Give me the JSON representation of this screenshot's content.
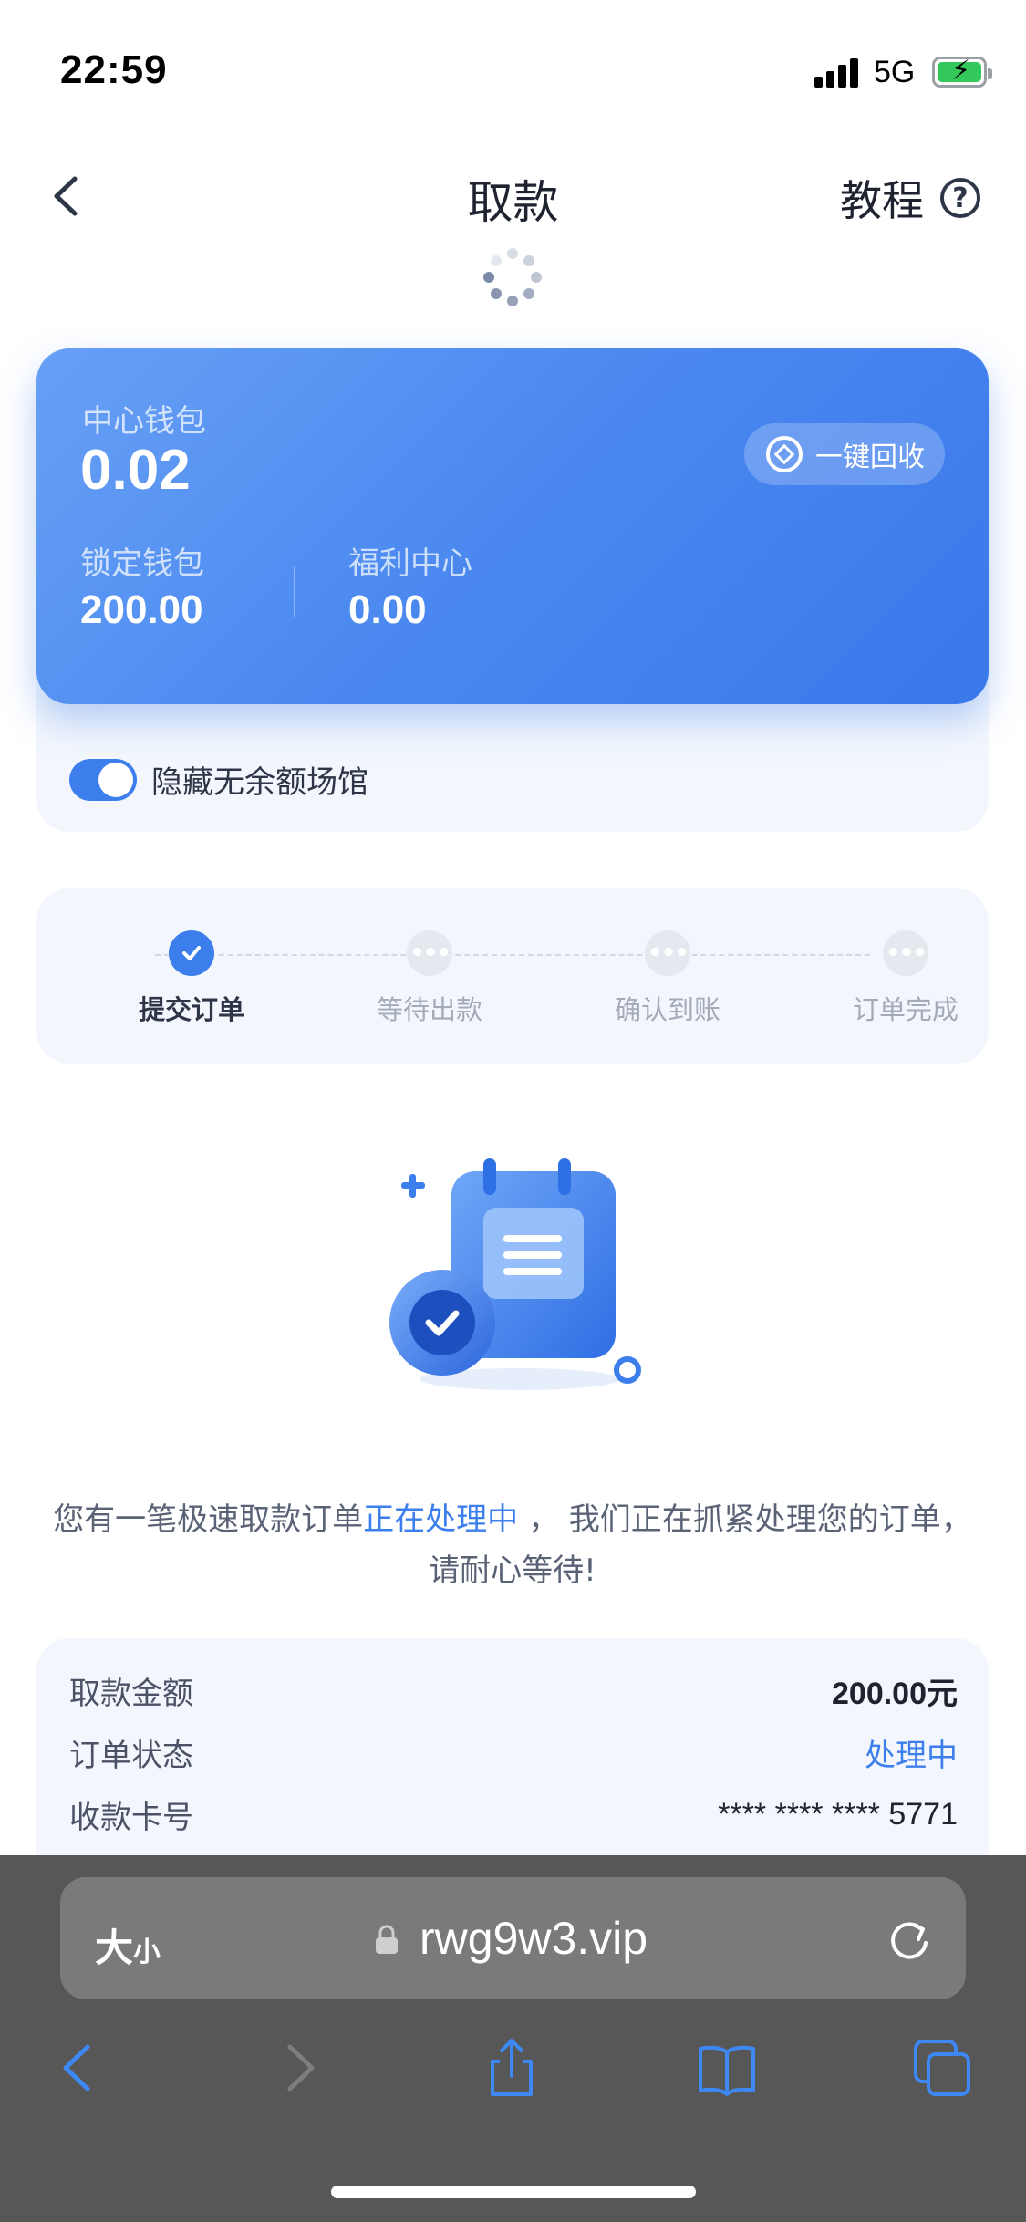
{
  "status_bar": {
    "time": "22:59",
    "network": "5G"
  },
  "nav": {
    "title": "取款",
    "tutorial": "教程"
  },
  "wallet": {
    "main_label": "中心钱包",
    "main_value": "0.02",
    "locked_label": "锁定钱包",
    "locked_value": "200.00",
    "welfare_label": "福利中心",
    "welfare_value": "0.00",
    "recycle_label": "一键回收",
    "hide_toggle_label": "隐藏无余额场馆",
    "hide_toggle_on": true
  },
  "steps": [
    {
      "label": "提交订单",
      "state": "done"
    },
    {
      "label": "等待出款",
      "state": "pending"
    },
    {
      "label": "确认到账",
      "state": "pending"
    },
    {
      "label": "订单完成",
      "state": "pending"
    }
  ],
  "message": {
    "prefix": "您有一笔极速取款订单",
    "highlight": "正在处理中",
    "suffix": " ，  我们正在抓紧处理您的订单，",
    "line2": "请耐心等待!"
  },
  "order": {
    "amount_label": "取款金额",
    "amount_value": "200.00元",
    "status_label": "订单状态",
    "status_value": "处理中",
    "card_label": "收款卡号",
    "card_value": "**** **** **** 5771"
  },
  "browser": {
    "text_size_big": "大",
    "text_size_small": "小",
    "url": "rwg9w3.vip"
  },
  "colors": {
    "accent": "#3d7eed",
    "card_start": "#67a0f5",
    "card_end": "#3878ea",
    "toolbar": "#575757"
  }
}
